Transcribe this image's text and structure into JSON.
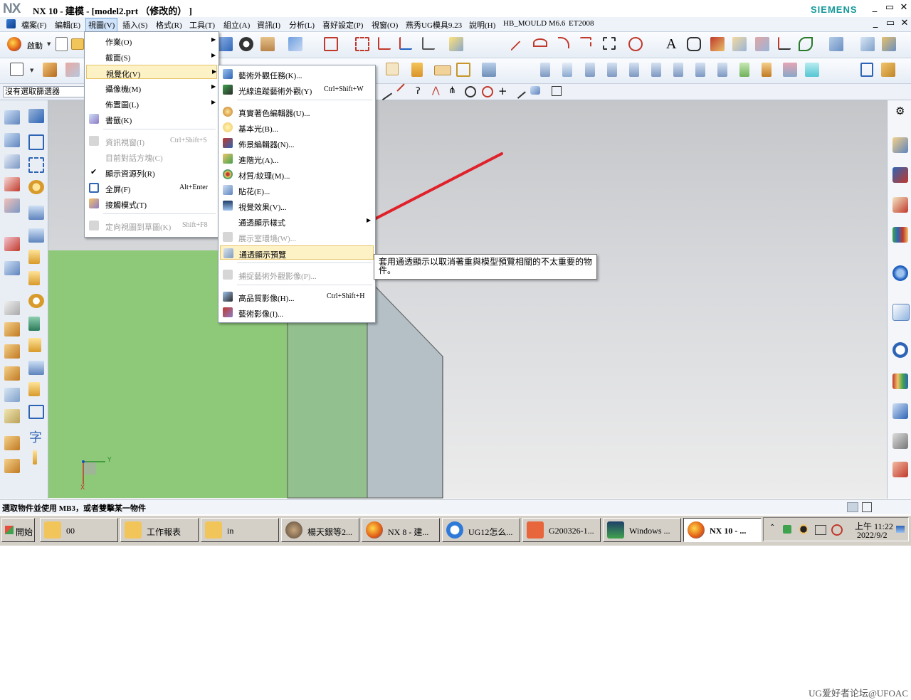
{
  "window": {
    "logo": "NX",
    "title": "NX 10 - 建模 - [model2.prt （修改的） ]",
    "brand": "SIEMENS",
    "controls": [
      "_",
      "▭",
      "✕"
    ],
    "doc_controls": [
      "_",
      "▭",
      "✕"
    ]
  },
  "menubar": {
    "items": [
      "檔案(F)",
      "編輯(E)",
      "視圖(V)",
      "插入(S)",
      "格式(R)",
      "工具(T)",
      "組立(A)",
      "資訊(I)",
      "分析(L)",
      "喜好設定(P)",
      "視窗(O)",
      "燕秀UG模具9.23",
      "說明(H)",
      "HB_MOULD M6.6",
      "ET2008"
    ],
    "active": "視圖(V)"
  },
  "toolbar": {
    "start_label": "啟動",
    "filter_value": "沒有選取篩選器"
  },
  "view_menu": {
    "items": [
      {
        "label": "作業(O)",
        "submenu": true
      },
      {
        "label": "截面(S)",
        "submenu": true
      },
      {
        "label": "視覺化(V)",
        "submenu": true,
        "highlighted": true
      },
      {
        "label": "攝像機(M)",
        "submenu": true
      },
      {
        "label": "佈置圖(L)",
        "submenu": true
      },
      {
        "label": "書籤(K)"
      },
      {
        "label": "資訊視窗(I)",
        "shortcut": "Ctrl+Shift+S",
        "disabled": true
      },
      {
        "label": "目前對話方塊(C)",
        "disabled": true
      },
      {
        "label": "顯示資源列(R)",
        "checked": true
      },
      {
        "label": "全屏(F)",
        "shortcut": "Alt+Enter"
      },
      {
        "label": "接觸模式(T)"
      },
      {
        "label": "定向視圖到草圖(K)",
        "shortcut": "Shift+F8",
        "disabled": true
      }
    ]
  },
  "viz_submenu": {
    "items": [
      {
        "label": "藝術外觀任務(K)..."
      },
      {
        "label": "光線追蹤藝術外觀(Y)",
        "shortcut": "Ctrl+Shift+W"
      },
      {
        "label": "真實著色編輯器(U)..."
      },
      {
        "label": "基本光(B)..."
      },
      {
        "label": "佈景編輯器(N)..."
      },
      {
        "label": "進階光(A)..."
      },
      {
        "label": "材質/紋理(M)..."
      },
      {
        "label": "貼花(E)..."
      },
      {
        "label": "視覺效果(V)..."
      },
      {
        "label": "通透顯示樣式",
        "submenu": true
      },
      {
        "label": "展示室環境(W)...",
        "disabled": true
      },
      {
        "label": "通透顯示預覽",
        "highlighted": true
      },
      {
        "label": "捕捉藝術外觀影像(P)...",
        "disabled": true
      },
      {
        "label": "高品質影像(H)...",
        "shortcut": "Ctrl+Shift+H"
      },
      {
        "label": "藝術影像(I)..."
      }
    ]
  },
  "tooltip": {
    "text": "套用通透顯示以取消著重與模型預覽相關的不太重要的物件。"
  },
  "triad": {
    "x": "X",
    "y": "Y"
  },
  "status": {
    "prompt": "選取物件並使用 MB3，或者雙擊某一物件"
  },
  "taskbar": {
    "start": "開始",
    "tasks": [
      {
        "label": "00"
      },
      {
        "label": "工作報表"
      },
      {
        "label": "in"
      },
      {
        "label": "楊天銀等2..."
      },
      {
        "label": "NX 8 - 建..."
      },
      {
        "label": "UG12怎么..."
      },
      {
        "label": "G200326-1..."
      },
      {
        "label": "Windows ..."
      },
      {
        "label": "NX 10 - ...",
        "active": true
      }
    ],
    "tray_time": "上午 11:22",
    "tray_date": "2022/9/2"
  },
  "watermark": "UG爱好者论坛@UFOAC",
  "colors": {
    "menu_highlight": "#fdf1c6",
    "green_face": "#8ec879",
    "annotation_arrow": "#e0212a"
  }
}
